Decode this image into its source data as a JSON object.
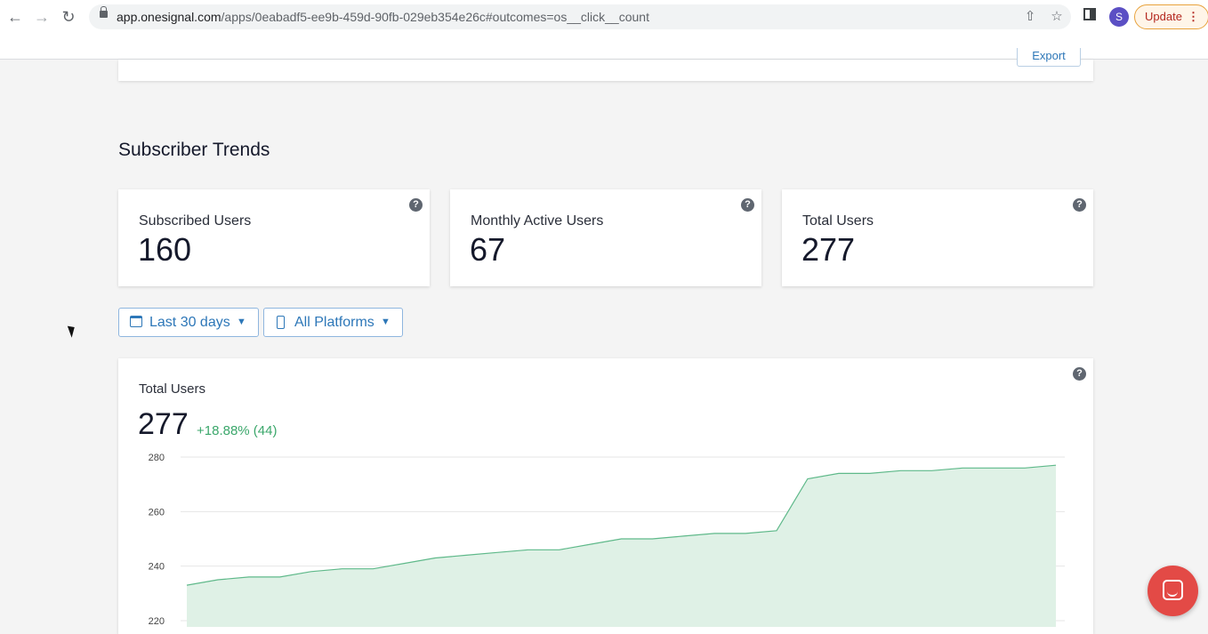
{
  "browser": {
    "url_host": "app.onesignal.com",
    "url_path": "/apps/0eabadf5-ee9b-459d-90fb-029eb354e26c#outcomes=os__click__count",
    "profile_initial": "S",
    "update_label": "Update"
  },
  "top_card": {
    "export_label": "Export"
  },
  "section": {
    "title": "Subscriber Trends"
  },
  "stats": [
    {
      "label": "Subscribed Users",
      "value": "160"
    },
    {
      "label": "Monthly Active Users",
      "value": "67"
    },
    {
      "label": "Total Users",
      "value": "277"
    }
  ],
  "filters": {
    "date_range": "Last 30 days",
    "platform": "All Platforms"
  },
  "chart_card": {
    "title": "Total Users",
    "value": "277",
    "change": "+18.88% (44)"
  },
  "chart_data": {
    "type": "area",
    "title": "Total Users",
    "xlabel": "",
    "ylabel": "",
    "ylim": [
      220,
      280
    ],
    "yticks": [
      220,
      240,
      260,
      280
    ],
    "grid": true,
    "series": [
      {
        "values": [
          233,
          235,
          236,
          236,
          238,
          239,
          239,
          241,
          243,
          244,
          245,
          246,
          246,
          248,
          250,
          250,
          251,
          252,
          252,
          253,
          272,
          274,
          274,
          275,
          275,
          276,
          276,
          276,
          277
        ]
      }
    ],
    "colors": {
      "line": "#5fb98a",
      "fill": "#dff1e6"
    }
  },
  "colors": {
    "accent": "#2d77b8",
    "positive": "#3ba76b",
    "chat": "#e34a46"
  }
}
